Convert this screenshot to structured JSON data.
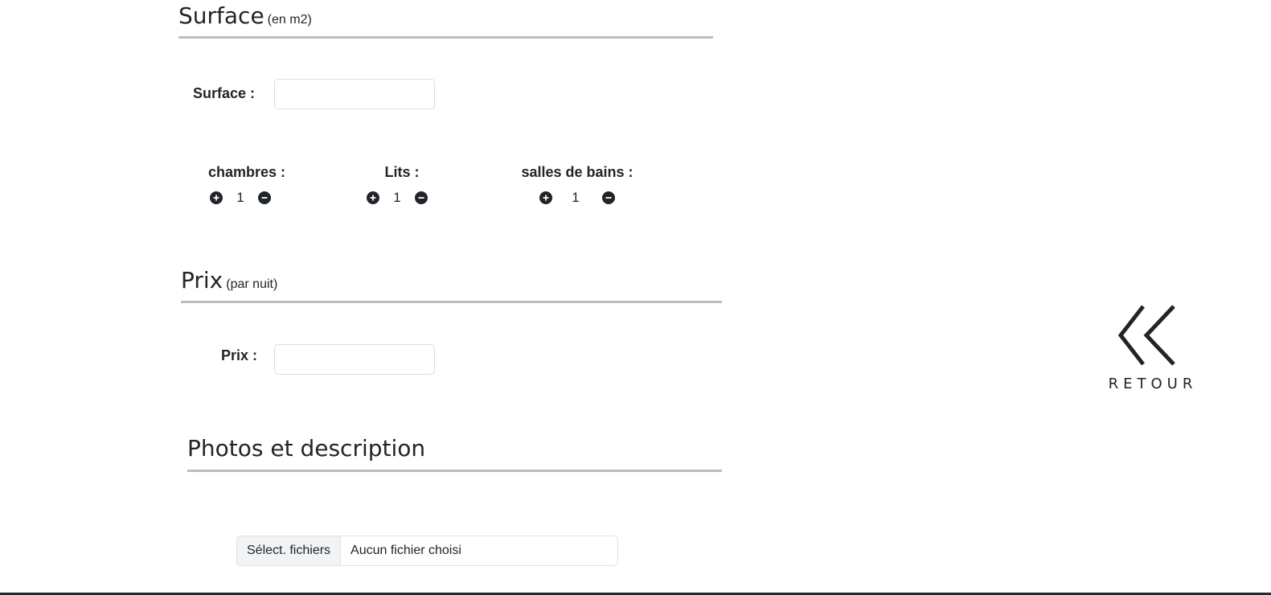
{
  "surface_section": {
    "title": "Surface",
    "subtitle": "(en m2)",
    "field_label": "Surface :",
    "field_value": ""
  },
  "counters": [
    {
      "label": "chambres :",
      "value": "1"
    },
    {
      "label": "Lits :",
      "value": "1"
    },
    {
      "label": "salles de bains :",
      "value": "1"
    }
  ],
  "price_section": {
    "title": "Prix",
    "subtitle": "(par nuit)",
    "field_label": "Prix :",
    "field_value": ""
  },
  "photos_section": {
    "title": "Photos et description"
  },
  "file_picker": {
    "button_label": "Sélect. fichiers",
    "status": "Aucun fichier choisi"
  },
  "back_link": {
    "label": "RETOUR",
    "icon": "double-chevron-left-icon"
  },
  "colors": {
    "text": "#212529",
    "rule": "#bdbdbd",
    "input_border": "#dcdcdc",
    "file_button_bg": "#f1f3f5"
  }
}
